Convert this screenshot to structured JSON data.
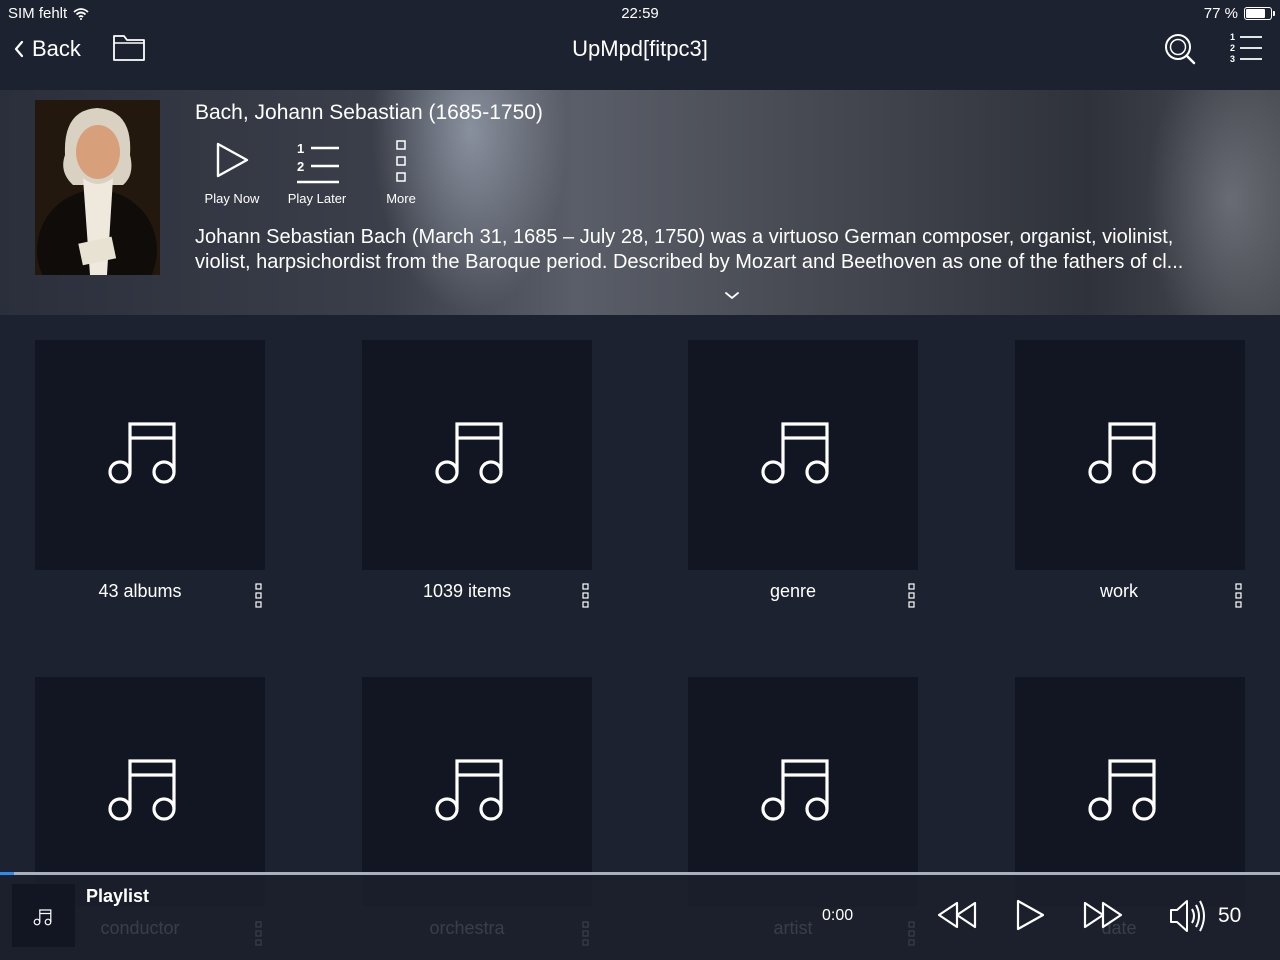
{
  "status_bar": {
    "carrier": "SIM fehlt",
    "time": "22:59",
    "battery": "77 %",
    "battery_level": 0.77
  },
  "nav": {
    "back_label": "Back",
    "title": "UpMpd[fitpc3]"
  },
  "artist": {
    "name": "Bach, Johann Sebastian (1685-1750)",
    "actions": [
      {
        "label": "Play Now",
        "icon": "play-icon"
      },
      {
        "label": "Play Later",
        "icon": "queue-icon"
      },
      {
        "label": "More",
        "icon": "more-icon"
      }
    ],
    "bio_line1": "Johann Sebastian Bach (March 31, 1685 – July 28, 1750) was a virtuoso German composer, organist, violinist,",
    "bio_line2": "violist, harpsichordist from the Baroque period. Described by Mozart and Beethoven as one of the fathers of cl..."
  },
  "grid": {
    "tiles": [
      {
        "label": "43 albums"
      },
      {
        "label": "1039 items"
      },
      {
        "label": "genre"
      },
      {
        "label": "work"
      },
      {
        "label": "conductor"
      },
      {
        "label": "orchestra"
      },
      {
        "label": "artist"
      },
      {
        "label": "date"
      }
    ]
  },
  "player": {
    "title": "Playlist",
    "time": "0:00",
    "progress": 0.01,
    "volume": "50"
  },
  "colors": {
    "background": "#1c2230",
    "tile": "#111622",
    "progress_accent": "#2d8cf0"
  }
}
